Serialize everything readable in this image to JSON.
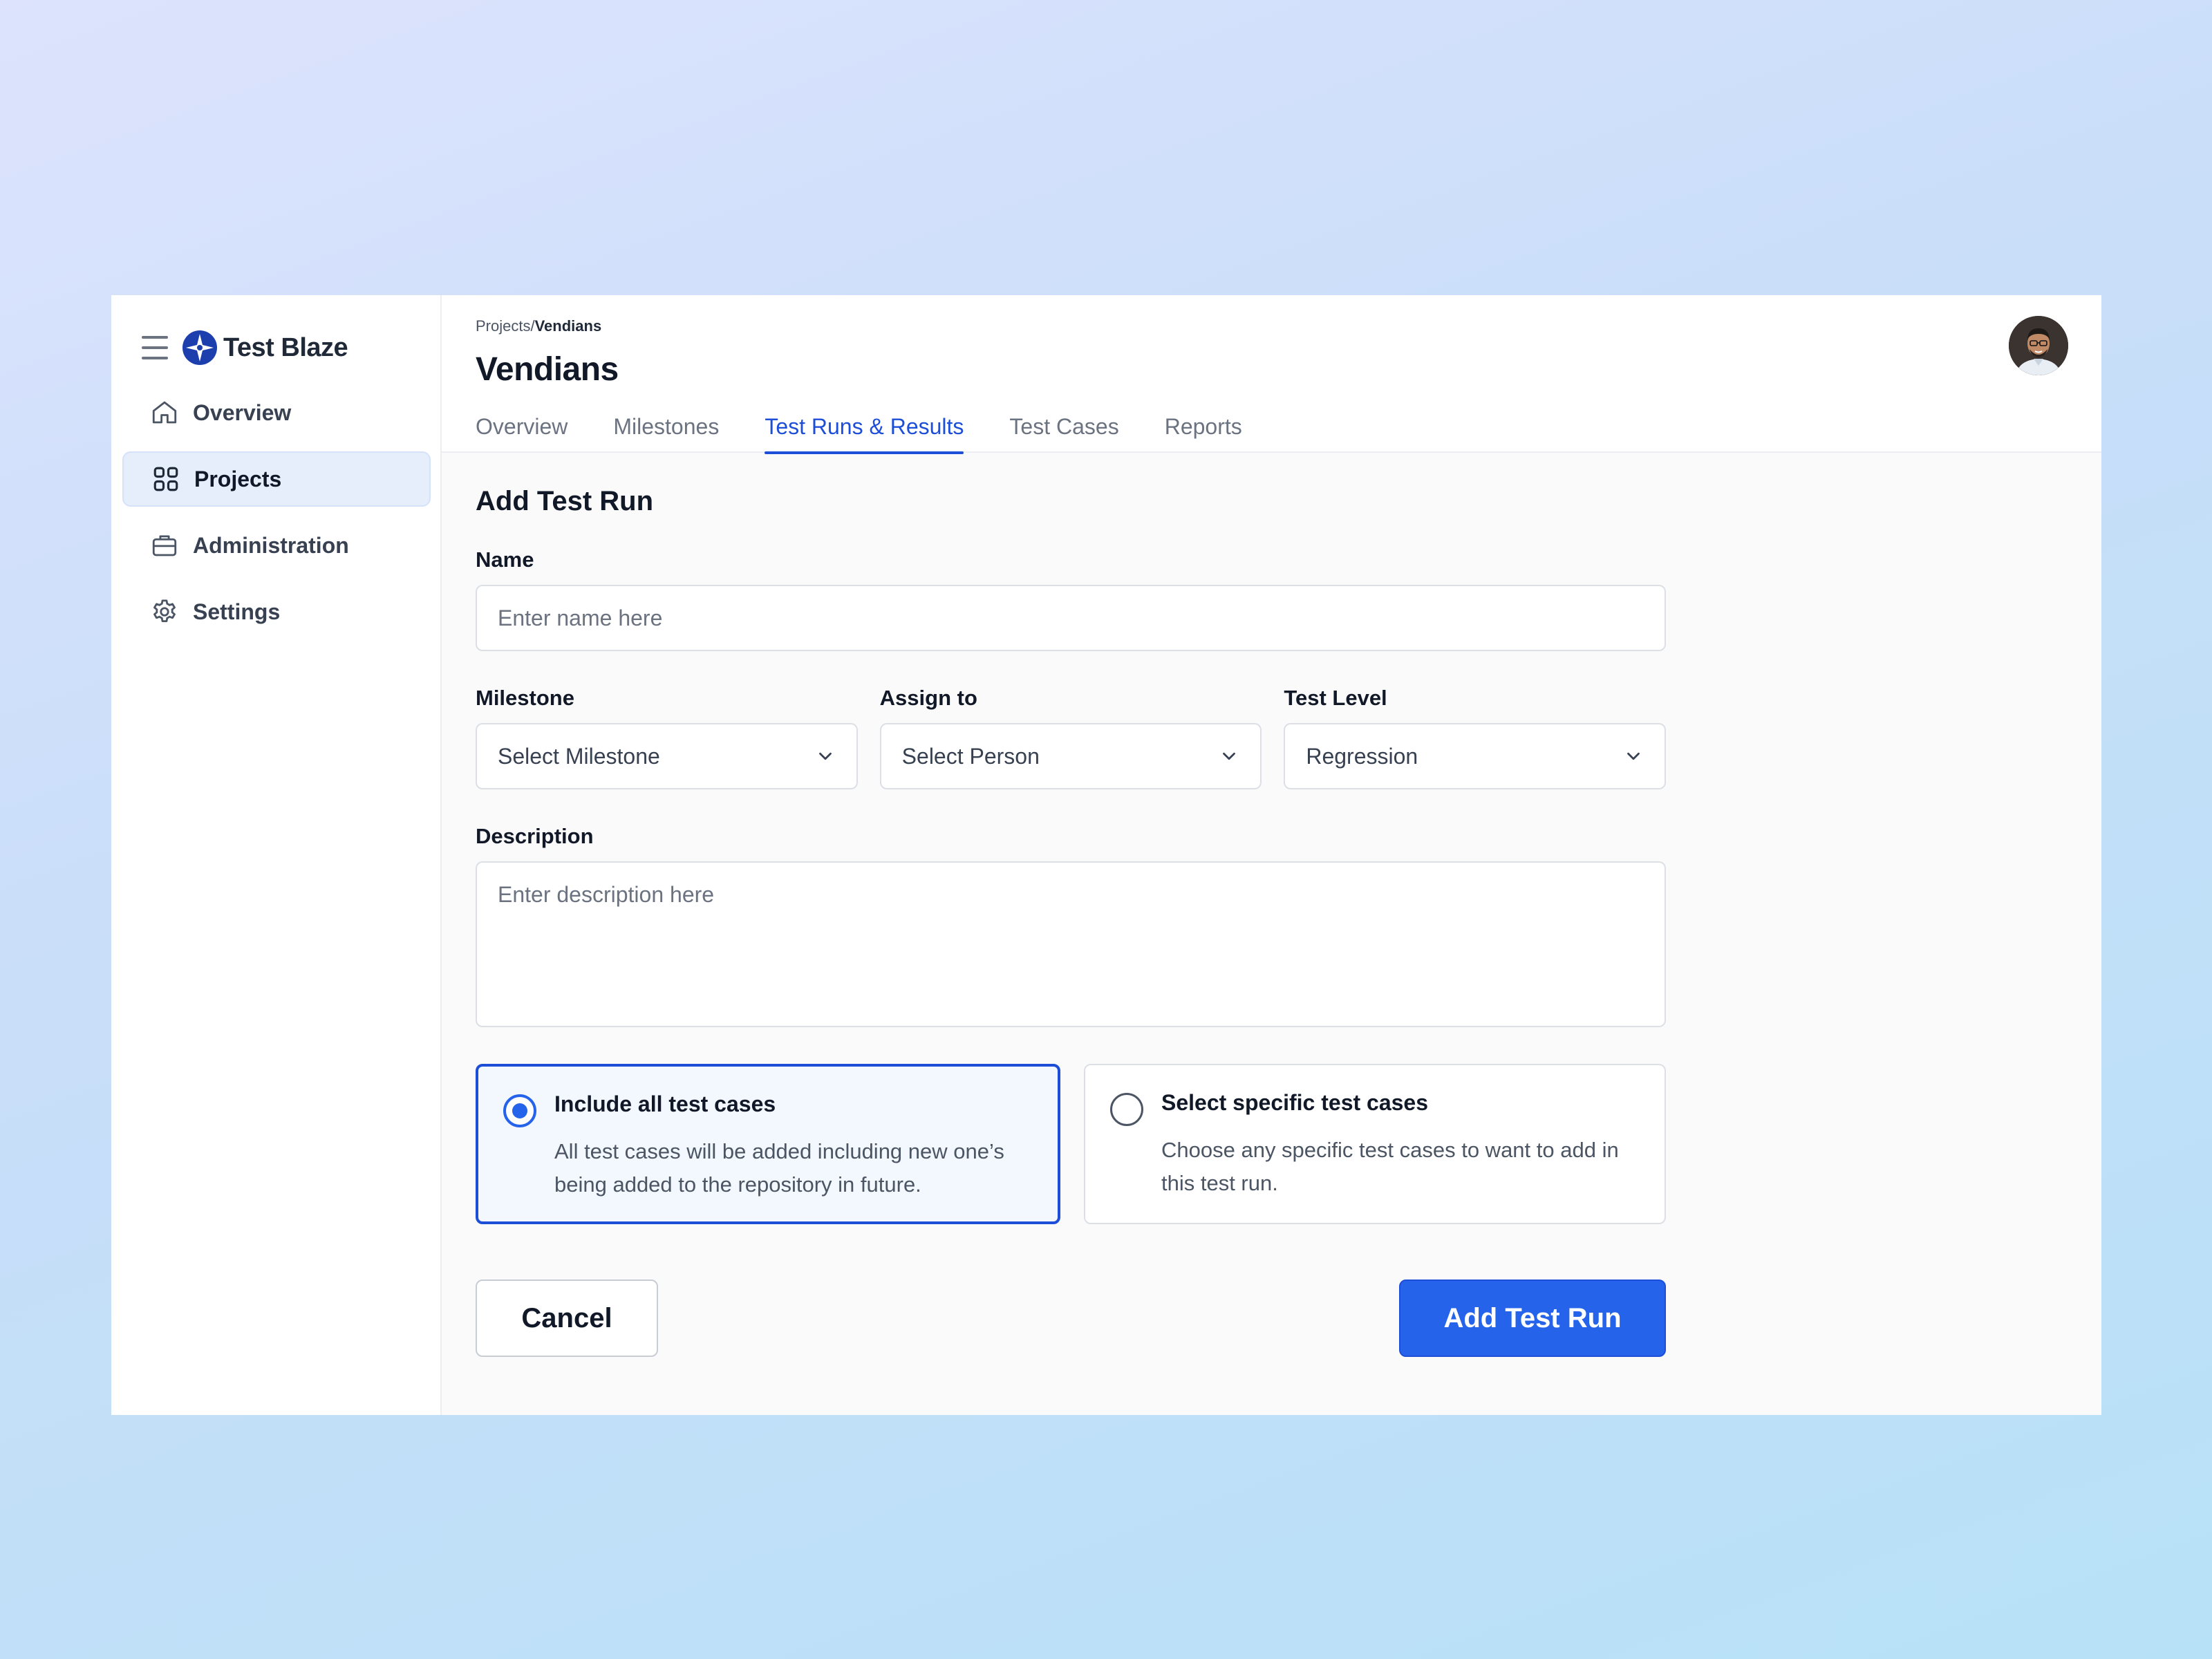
{
  "brand": {
    "name": "Test Blaze",
    "color": "#1d3fae"
  },
  "sidebar": {
    "items": [
      {
        "label": "Overview",
        "icon": "home-icon"
      },
      {
        "label": "Projects",
        "icon": "grid-icon",
        "active": true
      },
      {
        "label": "Administration",
        "icon": "briefcase-icon"
      },
      {
        "label": "Settings",
        "icon": "gear-icon"
      }
    ]
  },
  "header": {
    "breadcrumb_parent": "Projects/",
    "breadcrumb_current": "Vendians",
    "title": "Vendians",
    "tabs": [
      {
        "label": "Overview"
      },
      {
        "label": "Milestones"
      },
      {
        "label": "Test Runs & Results",
        "active": true
      },
      {
        "label": "Test Cases"
      },
      {
        "label": "Reports"
      }
    ]
  },
  "form": {
    "title": "Add Test Run",
    "name": {
      "label": "Name",
      "placeholder": "Enter name here",
      "value": ""
    },
    "milestone": {
      "label": "Milestone",
      "value": "Select Milestone"
    },
    "assign": {
      "label": "Assign to",
      "value": "Select Person"
    },
    "level": {
      "label": "Test Level",
      "value": "Regression"
    },
    "description": {
      "label": "Description",
      "placeholder": "Enter description here",
      "value": ""
    },
    "options": [
      {
        "title": "Include all test cases",
        "desc": "All test cases will be added including new one’s being added to the repository in future.",
        "selected": true
      },
      {
        "title": "Select specific test cases",
        "desc": "Choose any specific test cases to want to add in this test run.",
        "selected": false
      }
    ],
    "cancel_label": "Cancel",
    "submit_label": "Add Test Run"
  },
  "colors": {
    "accent": "#2563eb",
    "tab_active": "#1d4ed8",
    "nav_active_bg": "#e6eefc"
  }
}
